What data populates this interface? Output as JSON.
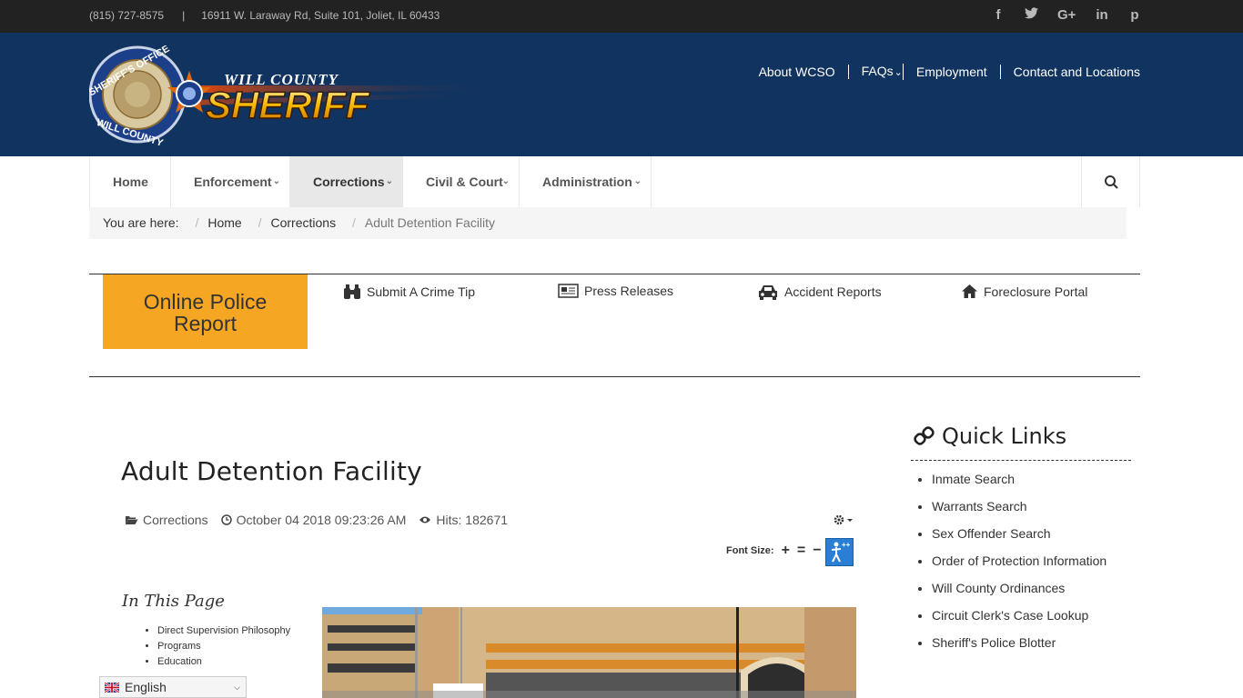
{
  "topbar": {
    "phone": "(815) 727-8575",
    "separator": "|",
    "address": "16911 W. Laraway Rd, Suite 101, Joliet, IL 60433",
    "social": [
      {
        "icon": "facebook-icon",
        "glyph": "f"
      },
      {
        "icon": "twitter-icon",
        "glyph": "t"
      },
      {
        "icon": "google-plus-icon",
        "glyph": "G+"
      },
      {
        "icon": "linkedin-icon",
        "glyph": "in"
      },
      {
        "icon": "pinterest-icon",
        "glyph": "p"
      }
    ]
  },
  "header": {
    "logo": {
      "line1": "WILL COUNTY",
      "line2": "SHERIFF",
      "badge_top": "SHERIFF'S OFFICE",
      "badge_bottom": "WILL COUNTY"
    },
    "links": [
      "About WCSO",
      "FAQs",
      "Employment",
      "Contact and Locations"
    ]
  },
  "nav": {
    "items": [
      "Home",
      "Enforcement",
      "Corrections",
      "Civil & Court",
      "Administration"
    ],
    "active": "Corrections"
  },
  "breadcrumb": {
    "prefix": "You are here:",
    "items": [
      "Home",
      "Corrections",
      "Adult Detention Facility"
    ]
  },
  "quick": {
    "online_report": "Online Police Report",
    "links": [
      {
        "label": "Submit A Crime Tip",
        "icon": "binoculars-icon"
      },
      {
        "label": "Press Releases",
        "icon": "newspaper-icon"
      },
      {
        "label": "Accident Reports",
        "icon": "car-icon"
      },
      {
        "label": "Foreclosure Portal",
        "icon": "home-icon"
      }
    ]
  },
  "article": {
    "title": "Adult Detention Facility",
    "category": "Corrections",
    "date": "October 04 2018 09:23:26 AM",
    "hits": "Hits: 182671",
    "font_size_label": "Font Size:",
    "in_this_page": "In This Page",
    "toc": [
      "Direct Supervision Philosophy",
      "Programs",
      "Education"
    ]
  },
  "language": {
    "selected": "English"
  },
  "sidebar": {
    "title": "Quick Links",
    "links": [
      "Inmate Search",
      "Warrants Search",
      "Sex Offender Search",
      "Order of Protection Information",
      "Will County Ordinances",
      "Circuit Clerk's Case Lookup",
      "Sheriff's Police Blotter"
    ]
  },
  "colors": {
    "topbar": "#222222",
    "header": "#11335f",
    "accent": "#f5a623"
  }
}
